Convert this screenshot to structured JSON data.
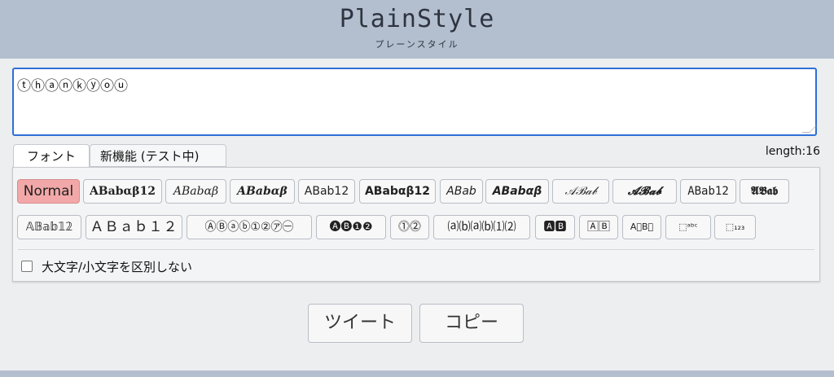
{
  "header": {
    "logo": "PlainStyle",
    "subtitle": "プレーンスタイル"
  },
  "editor": {
    "value": "ⓣⓗⓐⓝⓚⓨⓞⓤ"
  },
  "tabs": [
    {
      "label": "フォント"
    },
    {
      "label": "新機能 (テスト中)"
    }
  ],
  "length_text": "length:16",
  "styles": [
    {
      "label": "Normal"
    },
    {
      "label": "𝐀𝐁𝐚𝐛𝛂𝛃𝟏𝟐"
    },
    {
      "label": "𝐴𝐵𝑎𝑏𝛼𝛽"
    },
    {
      "label": "𝑨𝑩𝒂𝒃𝜶𝜷"
    },
    {
      "label": "𝖠𝖡𝖺𝖻𝟣𝟤"
    },
    {
      "label": "𝗔𝗕𝗮𝗯𝝰𝝱𝟭𝟮"
    },
    {
      "label": "𝘈𝘉𝘢𝘣"
    },
    {
      "label": "𝘼𝘽𝙖𝙗𝞪𝞫"
    },
    {
      "label": "𝒜ℬ𝒶𝒷"
    },
    {
      "label": "𝓐𝓑𝓪𝓫"
    },
    {
      "label": "𝙰𝙱𝚊𝚋𝟷𝟸"
    },
    {
      "label": "𝕬𝕭𝖆𝖇"
    },
    {
      "label": "𝔸𝔹𝕒𝕓𝟙𝟚"
    },
    {
      "label": "ＡＢａｂ１２"
    },
    {
      "label": "ⒶⒷⓐⓑ①②㋐㊀"
    },
    {
      "label": "🅐🅑❶❷"
    },
    {
      "label": "⓵⓶"
    },
    {
      "label": "⒜⒝⒜⒝⑴⑵"
    },
    {
      "label": "🅰🅱"
    },
    {
      "label": "🄰🄱"
    },
    {
      "label": "A⃞B⃞"
    },
    {
      "label": "⬚ᵃᵇᶜ"
    },
    {
      "label": "⬚₁₂₃"
    }
  ],
  "ignore_case": {
    "label": "大文字/小文字を区別しない"
  },
  "actions": {
    "tweet": "ツイート",
    "copy": "コピー"
  }
}
